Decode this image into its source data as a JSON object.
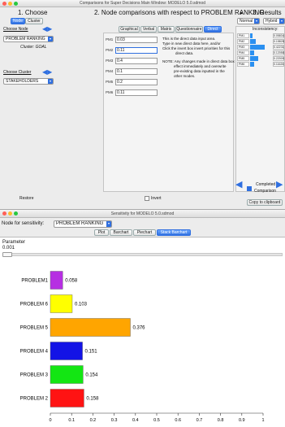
{
  "top_window": {
    "title": "Comparisons for Super Decisions Main Window: MODELO 5.0.sdmod",
    "col1_header": "1. Choose",
    "col2_header": "2. Node comparisons with respect to PROBLEM RANKING",
    "col3_header": "3. Results",
    "node_tab": "Node",
    "cluster_tab": "Cluster",
    "choose_node_label": "Choose Node",
    "node_value": "PROBLEM RANKING",
    "cluster_note": "Cluster: GOAL",
    "choose_cluster_label": "Choose Cluster",
    "cluster_value": "STAKEHOLDERS",
    "restore_button": "Restore",
    "mode_tabs": [
      "Graphical",
      "Verbal",
      "Matrix",
      "Questionnaire",
      "Direct"
    ],
    "direct_rows": [
      {
        "label": "PM1",
        "value": "0.03"
      },
      {
        "label": "PM2",
        "value": "0.11"
      },
      {
        "label": "PM3",
        "value": "0.4"
      },
      {
        "label": "PM4",
        "value": "0.1"
      },
      {
        "label": "PM5",
        "value": "0.2"
      },
      {
        "label": "PM6",
        "value": "0.11"
      }
    ],
    "help_text_1": "This is the direct data input area.",
    "help_text_2": "Type in new direct data here, and/or",
    "help_text_3": "Click the invert box invert priorities for this",
    "help_text_4": "direct data.",
    "note_1": "NOTE: Any changes made in direct data box",
    "note_2": "effect immediately and overwrite",
    "note_3": "pre-existing data inputted in the",
    "note_4": "other modes.",
    "invert_label": "Invert",
    "results_mode": "Normal",
    "results_type": "Hybrid",
    "inconsistency_label": "Inconsistency:",
    "result_rows": [
      {
        "label": "PM1",
        "value": "0.05834",
        "fraction": 0.06
      },
      {
        "label": "PM2",
        "value": "0.15828",
        "fraction": 0.16
      },
      {
        "label": "PM3",
        "value": "0.42231",
        "fraction": 0.42
      },
      {
        "label": "PM4",
        "value": "0.12058",
        "fraction": 0.12
      },
      {
        "label": "PM5",
        "value": "0.22009",
        "fraction": 0.22
      },
      {
        "label": "PM6",
        "value": "0.11626",
        "fraction": 0.12
      }
    ],
    "completed_label": "Completed",
    "comparison_label": "Comparison",
    "copy_button": "Copy to clipboard"
  },
  "bottom_window": {
    "title": "Sensitivity for MODELO 5.0.sdmod",
    "node_label": "Node for sensitivity:",
    "node_value": "PROBLEM RANKING",
    "tabs": [
      "Plot",
      "Barchart",
      "Piechart",
      "Stack Barchart"
    ],
    "parameter_label": "Parameter",
    "parameter_value": "0.001"
  },
  "chart_data": {
    "type": "bar",
    "orientation": "horizontal",
    "categories": [
      "PROBLEM1",
      "PROBLEM 6",
      "PROBLEM 5",
      "PROBLEM 4",
      "PROBLEM 3",
      "PROBLEM 2"
    ],
    "values": [
      0.058,
      0.103,
      0.376,
      0.151,
      0.154,
      0.158
    ],
    "value_labels": [
      "0.058",
      "0.103",
      "0.376",
      "0.151",
      "0.154",
      "0.158"
    ],
    "colors": [
      "#b62fe2",
      "#ffff00",
      "#ffa500",
      "#1313e6",
      "#13e613",
      "#ff1313"
    ],
    "xlim": [
      0,
      1
    ],
    "xticks": [
      "0",
      "0.1",
      "0.2",
      "0.3",
      "0.4",
      "0.5",
      "0.6",
      "0.7",
      "0.8",
      "0.9",
      "1"
    ]
  }
}
